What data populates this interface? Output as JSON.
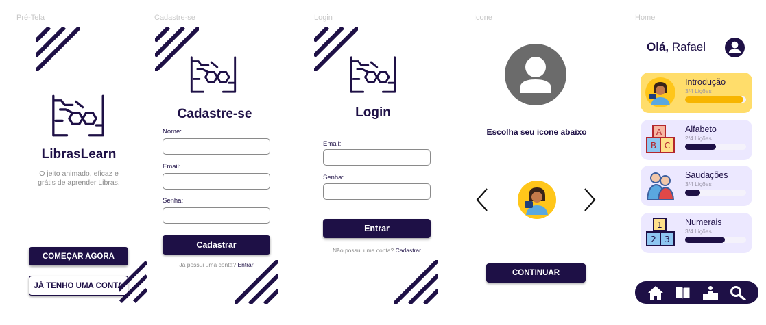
{
  "frames": {
    "pre_tela": "Pré-Tela",
    "cadastre": "Cadastre-se",
    "login": "Login",
    "icone": "Icone",
    "home": "Home"
  },
  "pre_tela": {
    "brand": "LibrasLearn",
    "tagline_1": "O jeito animado, eficaz e",
    "tagline_2": "grátis de aprender Libras.",
    "start_button": "COMEÇAR AGORA",
    "have_account_button": "JÁ TENHO UMA CONTA"
  },
  "cadastro": {
    "title": "Cadastre-se",
    "name_label": "Nome:",
    "email_label": "Email:",
    "password_label": "Senha:",
    "submit": "Cadastrar",
    "footer_text": "Já possui uma conta?",
    "footer_link": "Entrar"
  },
  "login": {
    "title": "Login",
    "email_label": "Email:",
    "password_label": "Senha:",
    "submit": "Entrar",
    "footer_text": "Não possui uma conta?",
    "footer_link": "Cadastrar"
  },
  "icone": {
    "heading": "Escolha seu icone abaixo",
    "prev": "<",
    "next": ">",
    "continue": "CONTINUAR"
  },
  "home": {
    "greeting_bold": "Olá,",
    "greeting_name": "Rafael",
    "courses": [
      {
        "title": "Introdução",
        "progress_text": "3/4 Lições",
        "progress": 0.95,
        "icon": "student-avatar-icon"
      },
      {
        "title": "Alfabeto",
        "progress_text": "2/4 Lições",
        "progress": 0.5,
        "icon": "abc-blocks-icon"
      },
      {
        "title": "Saudações",
        "progress_text": "3/4 Lições",
        "progress": 0.25,
        "icon": "greeting-people-icon"
      },
      {
        "title": "Numerais",
        "progress_text": "3/4 Lições",
        "progress": 0.65,
        "icon": "number-blocks-icon"
      }
    ],
    "nav": [
      "home-icon",
      "book-icon",
      "ranking-icon",
      "search-icon"
    ]
  },
  "colors": {
    "brand_dark": "#1e1046",
    "card_active": "#ffdd6b",
    "card": "#ece8ff",
    "progress_active": "#f7b500",
    "label_gray": "#c8c8c8"
  }
}
